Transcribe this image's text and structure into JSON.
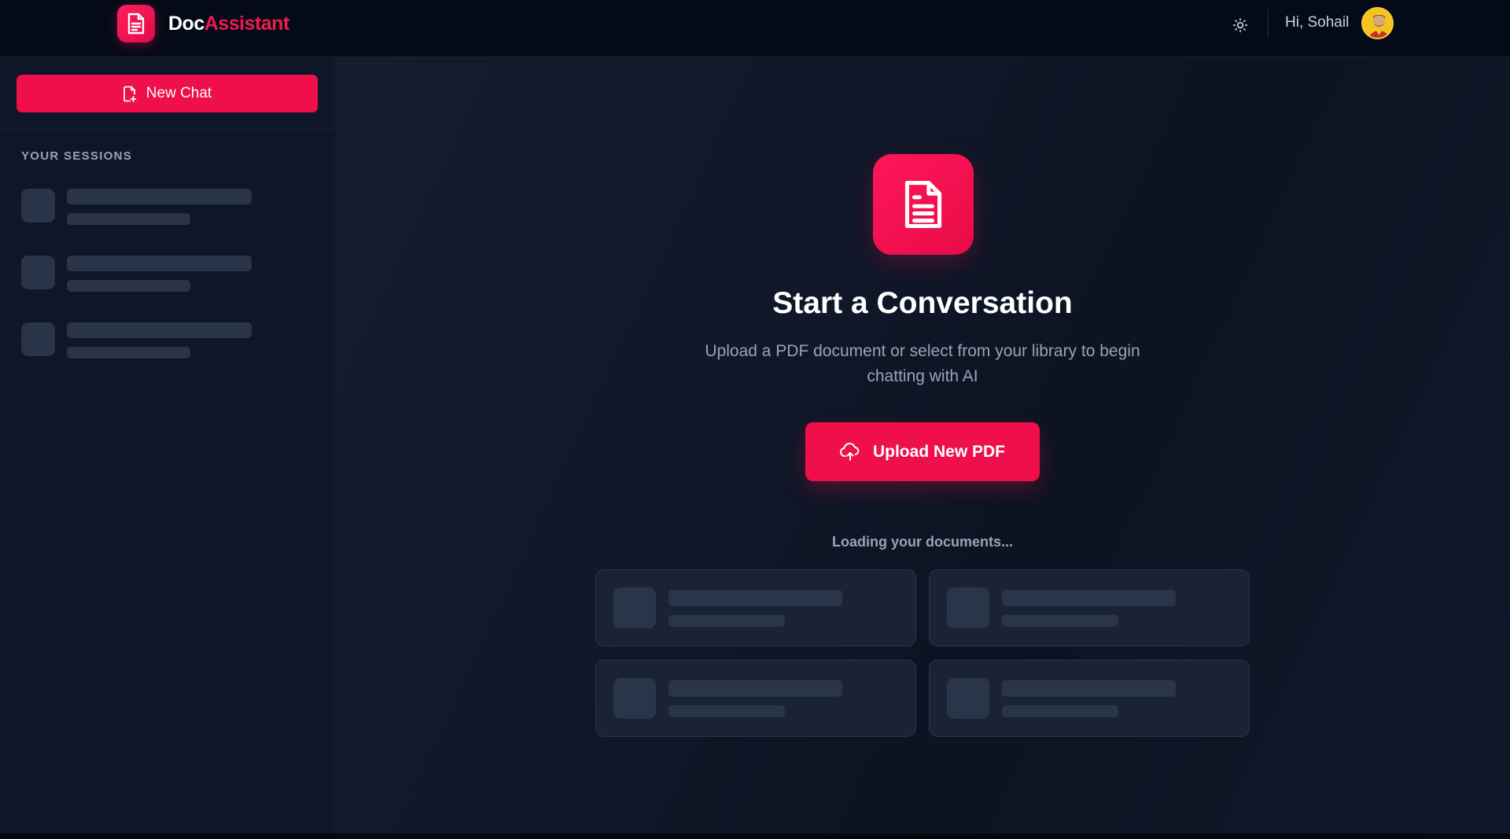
{
  "header": {
    "brand": {
      "part1": "Doc",
      "part2": "Assistant"
    },
    "greeting": "Hi, Sohail",
    "icons": {
      "logo": "document-icon",
      "theme": "sun-icon",
      "avatar": "user-avatar"
    }
  },
  "sidebar": {
    "new_chat_label": "New Chat",
    "new_chat_icon": "new-document-icon",
    "sessions_heading": "YOUR SESSIONS",
    "loading_session_placeholders": 3
  },
  "main": {
    "title": "Start a Conversation",
    "subtitle": "Upload a PDF document or select from your library to begin chatting with AI",
    "upload_label": "Upload New PDF",
    "upload_icon": "cloud-upload-icon",
    "loading_text": "Loading your documents...",
    "loading_document_placeholders": 4
  },
  "colors": {
    "accent": "#ee0f4b",
    "background": "#0b1120",
    "header_bg": "#050a18",
    "sidebar_bg": "#0e1627",
    "skeleton": "#2a3448"
  }
}
